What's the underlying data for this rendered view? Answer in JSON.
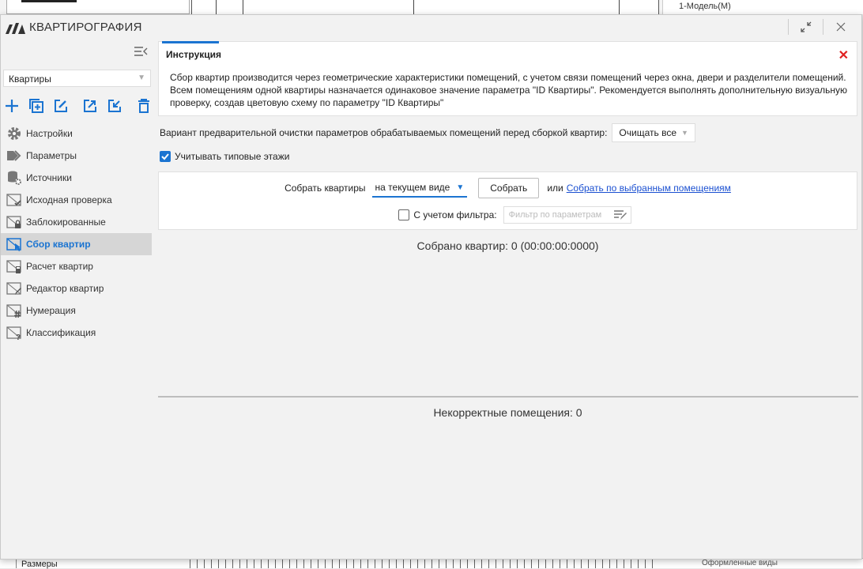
{
  "background": {
    "tree_item": "1-Модель(М)",
    "bottom_left": "Размеры",
    "bottom_right": "Оформленные виды"
  },
  "window": {
    "title": "КВАРТИРОГРАФИЯ"
  },
  "sidebar": {
    "dataset_select": "Квартиры",
    "items": [
      {
        "label": "Настройки",
        "icon": "gear-icon"
      },
      {
        "label": "Параметры",
        "icon": "tags-icon"
      },
      {
        "label": "Источники",
        "icon": "database-gear-icon"
      },
      {
        "label": "Исходная проверка",
        "icon": "envelope-check-icon"
      },
      {
        "label": "Заблокированные",
        "icon": "envelope-lock-icon"
      },
      {
        "label": "Сбор квартир",
        "icon": "envelope-cursor-icon"
      },
      {
        "label": "Расчет квартир",
        "icon": "envelope-calculator-icon"
      },
      {
        "label": "Редактор квартир",
        "icon": "envelope-pencil-icon"
      },
      {
        "label": "Нумерация",
        "icon": "envelope-hash-icon"
      },
      {
        "label": "Классификация",
        "icon": "envelope-question-icon"
      }
    ]
  },
  "instruction": {
    "title": "Инструкция",
    "text": "Сбор квартир производится через геометрические характеристики помещений, с учетом связи помещений через окна, двери и разделители помещений. Всем помещениям одной квартиры назначается одинаковое значение параметра \"ID Квартиры\". Рекомендуется выполнять дополнительную визуальную проверку, создав цветовую схему по параметру \"ID Квартиры\""
  },
  "cleanup": {
    "label": "Вариант предварительной очистки параметров обрабатываемых помещений перед сборкой квартир:",
    "value": "Очищать все"
  },
  "typical_floors": {
    "label": "Учитывать типовые этажи",
    "checked": true
  },
  "collect": {
    "label": "Собрать квартиры",
    "mode": "на текущем виде",
    "button": "Собрать",
    "or": "или",
    "link": "Собрать по выбранным помещениям",
    "filter_label": "С учетом фильтра:",
    "filter_placeholder": "Фильтр по параметрам",
    "filter_checked": false
  },
  "status": {
    "collected": "Собрано квартир: 0 (00:00:00:0000)",
    "incorrect": "Некорректные помещения: 0"
  },
  "colors": {
    "accent": "#1b74d1",
    "close": "#e02020",
    "link": "#1b50d1"
  }
}
